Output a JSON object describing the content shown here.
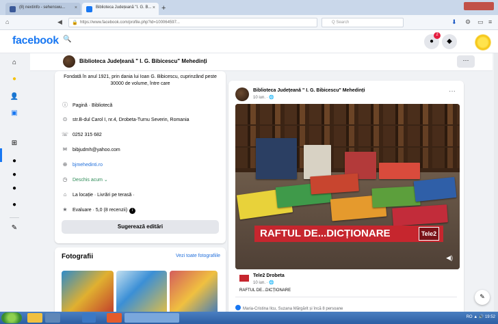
{
  "browser": {
    "tabs": [
      {
        "title": "(8) nextinfo - sehenswu...",
        "active": false
      },
      {
        "title": "Biblioteca Județeană \"I. G. B...",
        "active": true
      }
    ],
    "url": "https://www.facebook.com/profile.php?id=100064597...",
    "search_placeholder": "Q Search"
  },
  "facebook": {
    "logo": "facebook",
    "notification_count": "2"
  },
  "page": {
    "name": "Biblioteca Județeană \" I. G. Bibicescu\" Mehedinți",
    "more_label": "···"
  },
  "intro": {
    "description": "Fondată în anul 1921, prin dania lui Ioan G. Bibicescu, cuprinzând peste 30000 de volume, între care",
    "rows": [
      {
        "icon": "info-icon",
        "text": "Pagină · Bibliotecă"
      },
      {
        "icon": "location-icon",
        "text": "str.B-dul Carol I, nr.4, Drobeta-Turnu Severin, Romania"
      },
      {
        "icon": "phone-icon",
        "text": "0252 315 682"
      },
      {
        "icon": "email-icon",
        "text": "bibjudmh@yahoo.com"
      },
      {
        "icon": "globe-icon",
        "text": "bjmehedinti.ro"
      },
      {
        "icon": "clock-icon",
        "text": "Deschis acum ⌄"
      },
      {
        "icon": "service-icon",
        "text": "La locație · Livrări pe terasă ·"
      },
      {
        "icon": "star-icon",
        "text": "Evaluare · 5,0 (8 recenzii)"
      }
    ],
    "suggest_button": "Sugerează editări"
  },
  "photos": {
    "title": "Fotografii",
    "see_all": "Vezi toate fotografiile"
  },
  "post": {
    "author": "Biblioteca Județeană \" I. G. Bibicescu\" Mehedinți",
    "time": "10 iun. · 🌐",
    "video_caption": "RAFTUL DE...DICȚIONARE",
    "video_logo": "Tele2",
    "shared_from": "Tele2 Drobeta",
    "shared_time": "10 iun. · 🌐",
    "text": "RAFTUL DE...DICȚIONARE",
    "reactions": "Maria-Cristina Ilcu, Suzana Mărgărit și încă 8 persoane"
  },
  "taskbar": {
    "tray": "RO ▲ 🔊 19:52"
  },
  "colors": {
    "fb_blue": "#1877f2",
    "caption_red": "#c6262e",
    "page_bg": "#f0f2f5"
  }
}
